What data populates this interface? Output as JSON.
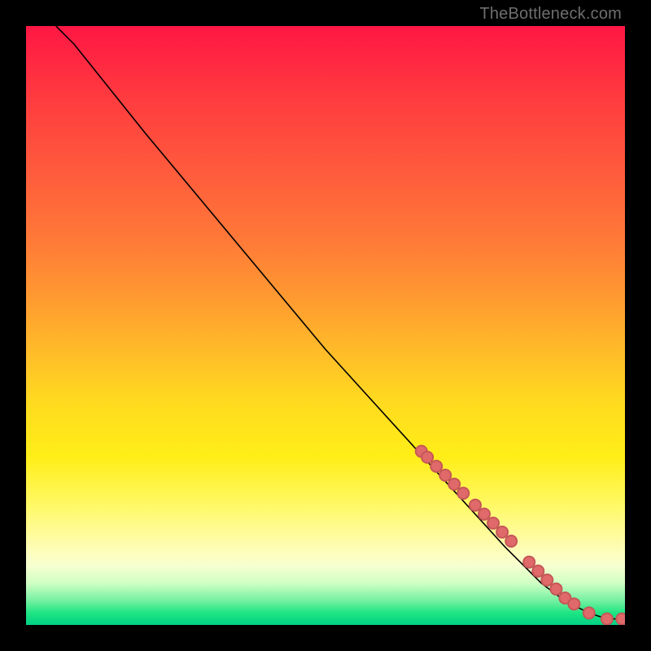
{
  "watermark": "TheBottleneck.com",
  "colors": {
    "background": "#000000",
    "marker_fill": "#e06a6a",
    "marker_stroke": "#c65757",
    "curve": "#000000"
  },
  "chart_data": {
    "type": "line",
    "title": "",
    "xlabel": "",
    "ylabel": "",
    "xlim": [
      0,
      100
    ],
    "ylim": [
      0,
      100
    ],
    "curve": {
      "x": [
        5,
        8,
        12,
        20,
        30,
        40,
        50,
        60,
        70,
        80,
        86,
        90,
        94,
        97,
        100
      ],
      "y": [
        100,
        97,
        92,
        82,
        70,
        58,
        46,
        35,
        24,
        13,
        7,
        4,
        2,
        1,
        1
      ]
    },
    "series": [
      {
        "name": "markers",
        "x": [
          66,
          67,
          68.5,
          70,
          71.5,
          73,
          75,
          76.5,
          78,
          79.5,
          81,
          84,
          85.5,
          87,
          88.5,
          90,
          91.5,
          94,
          97,
          99.5
        ],
        "y": [
          29,
          28,
          26.5,
          25,
          23.5,
          22,
          20,
          18.5,
          17,
          15.5,
          14,
          10.5,
          9,
          7.5,
          6,
          4.5,
          3.5,
          2,
          1,
          1
        ]
      }
    ]
  }
}
